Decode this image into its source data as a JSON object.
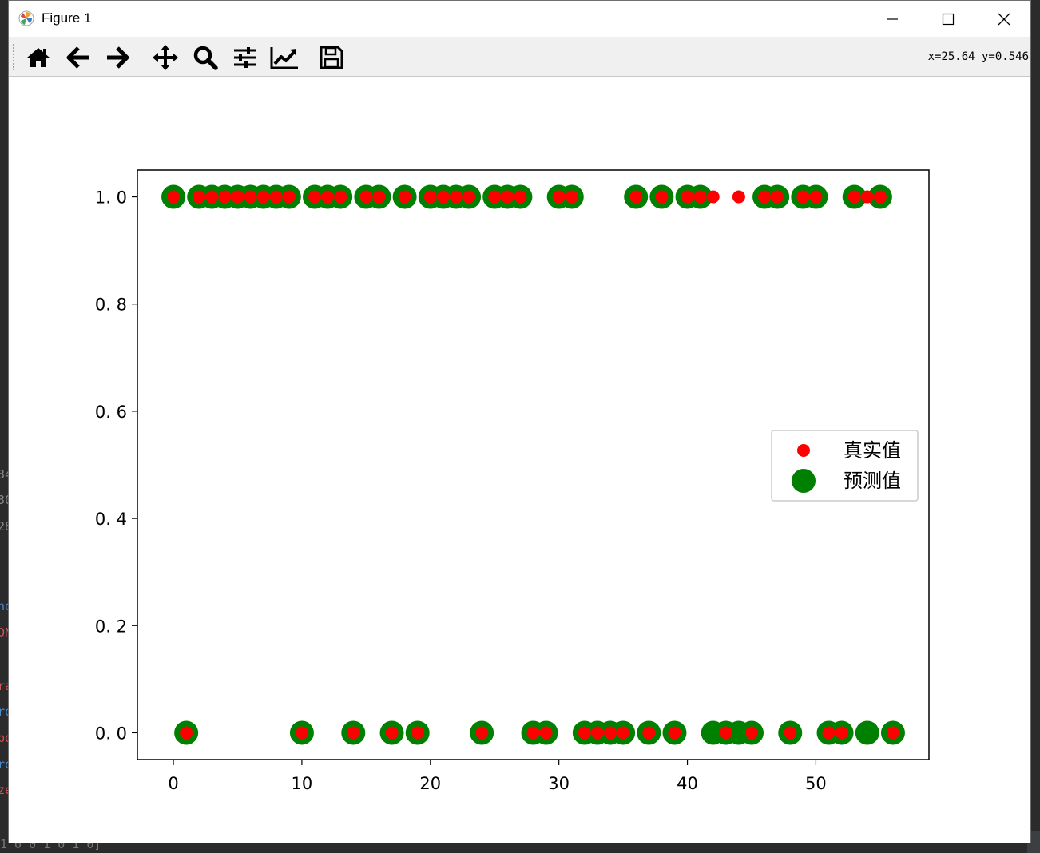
{
  "window": {
    "title": "Figure 1"
  },
  "toolbar": {
    "buttons": [
      {
        "icon": "home-icon"
      },
      {
        "icon": "arrow-left-icon"
      },
      {
        "icon": "arrow-right-icon"
      },
      {
        "icon": "move-icon"
      },
      {
        "icon": "zoom-icon"
      },
      {
        "icon": "sliders-icon"
      },
      {
        "icon": "chart-line-icon"
      },
      {
        "icon": "save-icon"
      }
    ],
    "coords": "x=25.64 y=0.546"
  },
  "colors": {
    "true": "#ff0000",
    "pred": "#008000"
  },
  "chart_data": {
    "type": "scatter",
    "xlim": [
      -2.8,
      58.8
    ],
    "ylim": [
      -0.05,
      1.05
    ],
    "xticks": [
      0,
      10,
      20,
      30,
      40,
      50
    ],
    "yticks": [
      0.0,
      0.2,
      0.4,
      0.6,
      0.8,
      1.0
    ],
    "ytick_labels": [
      "0. 0",
      "0. 2",
      "0. 4",
      "0. 6",
      "0. 8",
      "1. 0"
    ],
    "legend_position": "center-right",
    "grid": false,
    "series": [
      {
        "name": "真实值",
        "color": "#ff0000",
        "x": [
          0,
          1,
          2,
          3,
          4,
          5,
          6,
          7,
          8,
          9,
          10,
          11,
          12,
          13,
          14,
          15,
          16,
          17,
          18,
          19,
          20,
          21,
          22,
          23,
          24,
          25,
          26,
          27,
          28,
          29,
          30,
          31,
          32,
          33,
          34,
          35,
          36,
          37,
          38,
          39,
          40,
          41,
          42,
          43,
          44,
          45,
          46,
          47,
          48,
          49,
          50,
          51,
          52,
          53,
          54,
          55,
          56
        ],
        "values": [
          1,
          0,
          1,
          1,
          1,
          1,
          1,
          1,
          1,
          1,
          0,
          1,
          1,
          1,
          0,
          1,
          1,
          0,
          1,
          0,
          1,
          1,
          1,
          1,
          0,
          1,
          1,
          1,
          0,
          0,
          1,
          1,
          0,
          0,
          0,
          0,
          1,
          0,
          1,
          0,
          1,
          1,
          1,
          0,
          1,
          0,
          1,
          1,
          0,
          1,
          1,
          0,
          0,
          1,
          1,
          1,
          0
        ]
      },
      {
        "name": "预测值",
        "color": "#008000",
        "x": [
          0,
          1,
          2,
          3,
          4,
          5,
          6,
          7,
          8,
          9,
          10,
          11,
          12,
          13,
          14,
          15,
          16,
          17,
          18,
          19,
          20,
          21,
          22,
          23,
          24,
          25,
          26,
          27,
          28,
          29,
          30,
          31,
          32,
          33,
          34,
          35,
          36,
          37,
          38,
          39,
          40,
          41,
          42,
          43,
          44,
          45,
          46,
          47,
          48,
          49,
          50,
          51,
          52,
          53,
          54,
          55,
          56
        ],
        "values": [
          1,
          0,
          1,
          1,
          1,
          1,
          1,
          1,
          1,
          1,
          0,
          1,
          1,
          1,
          0,
          1,
          1,
          0,
          1,
          0,
          1,
          1,
          1,
          1,
          0,
          1,
          1,
          1,
          0,
          0,
          1,
          1,
          0,
          0,
          0,
          0,
          1,
          0,
          1,
          0,
          1,
          1,
          0,
          0,
          0,
          0,
          1,
          1,
          0,
          1,
          1,
          0,
          0,
          1,
          0,
          1,
          0
        ]
      }
    ]
  }
}
